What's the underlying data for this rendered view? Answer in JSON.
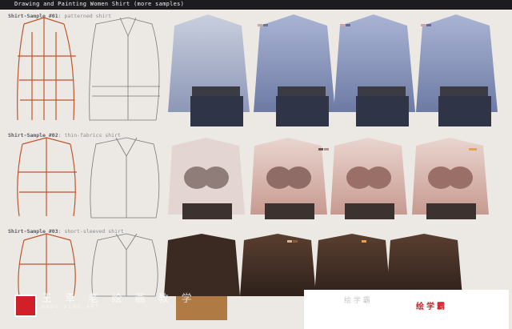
{
  "header": {
    "title": "Drawing and Painting Women Shirt (more samples)"
  },
  "rows": [
    {
      "label": "Shirt-Sample #01",
      "sub": "patterned shirt"
    },
    {
      "label": "Shirt-Sample #02",
      "sub": "thin-fabrics shirt"
    },
    {
      "label": "Shirt-Sample #03",
      "sub": "short-sleeved shirt"
    }
  ],
  "logo": {
    "text": "王 幸 老 绘 画 教 学",
    "sub": "WANG XING ART"
  },
  "brand": {
    "name": "绘学霸"
  },
  "watermark": {
    "text": "绘 学 霸"
  },
  "colors": {
    "header_bg": "#1c1b1f",
    "page_bg": "#ece9e4",
    "construction_lines": "#c0552d",
    "shirt_blue": "#9ba6c4",
    "shirt_pink": "#d7b6ae",
    "shirt_brown": "#4a3327",
    "brand_red": "#d0202a"
  }
}
